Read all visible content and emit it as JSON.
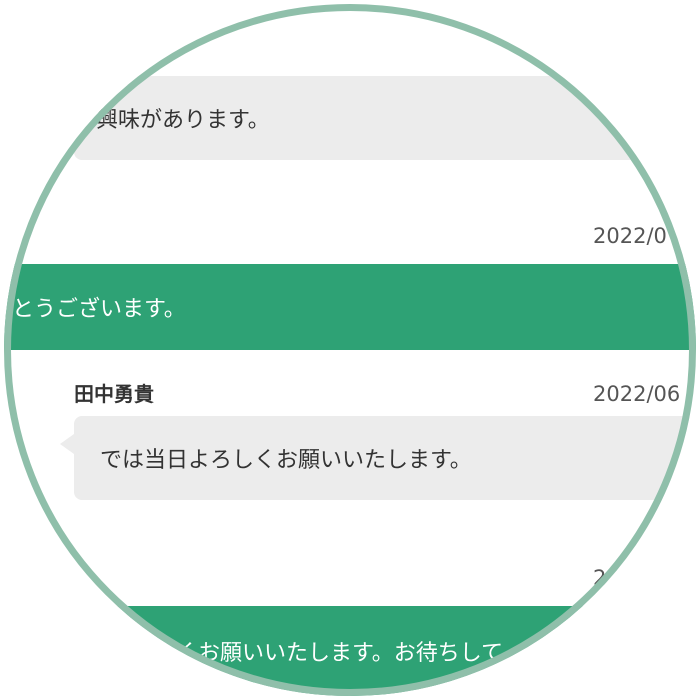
{
  "colors": {
    "accent_green": "#2ea275",
    "bubble_gray": "#ececec",
    "lens_ring": "#8fbfaa",
    "text": "#333333"
  },
  "messages": [
    {
      "type": "received",
      "text": "興味があります。"
    },
    {
      "type": "sent",
      "timestamp": "2022/0",
      "text": "とうございます。"
    },
    {
      "type": "received",
      "sender": "田中勇貴",
      "timestamp": "2022/06",
      "text": "では当日よろしくお願いいたします。"
    },
    {
      "type": "sent",
      "timestamp": "2",
      "text": "くお願いいたします。お待ちして"
    }
  ]
}
